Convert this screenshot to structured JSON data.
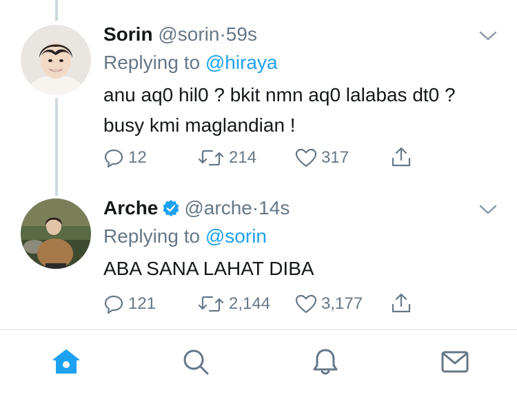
{
  "tweets": [
    {
      "name": "Sorin",
      "handle": "@sorin",
      "dot": "·",
      "time": "59s",
      "verified": false,
      "replying_prefix": "Replying to",
      "replying_to": "@hiraya",
      "body_lines": [
        "anu aq0 hil0 ? bkit nmn aq0 lalabas dt0 ?",
        "busy kmi maglandian !"
      ],
      "replies": "12",
      "retweets": "214",
      "likes": "317"
    },
    {
      "name": "Arche",
      "handle": "@arche",
      "dot": "·",
      "time": "14s",
      "verified": true,
      "replying_prefix": "Replying to",
      "replying_to": "@sorin",
      "body_lines": [
        "ABA SANA LAHAT DIBA"
      ],
      "replies": "121",
      "retweets": "2,144",
      "likes": "3,177"
    }
  ],
  "icons": {
    "reply": "reply-icon",
    "retweet": "retweet-icon",
    "like": "heart-icon",
    "share": "share-icon",
    "more": "chevron-down-icon",
    "verified": "verified-badge-icon"
  },
  "tabbar": [
    {
      "icon": "home-icon",
      "active": true
    },
    {
      "icon": "search-icon",
      "active": false
    },
    {
      "icon": "notifications-icon",
      "active": false
    },
    {
      "icon": "messages-icon",
      "active": false
    }
  ],
  "colors": {
    "accent": "#1da1f2",
    "secondary_text": "#657786",
    "primary_text": "#14171a",
    "thread_line": "#cfd9de",
    "divider": "#d6dde2"
  }
}
